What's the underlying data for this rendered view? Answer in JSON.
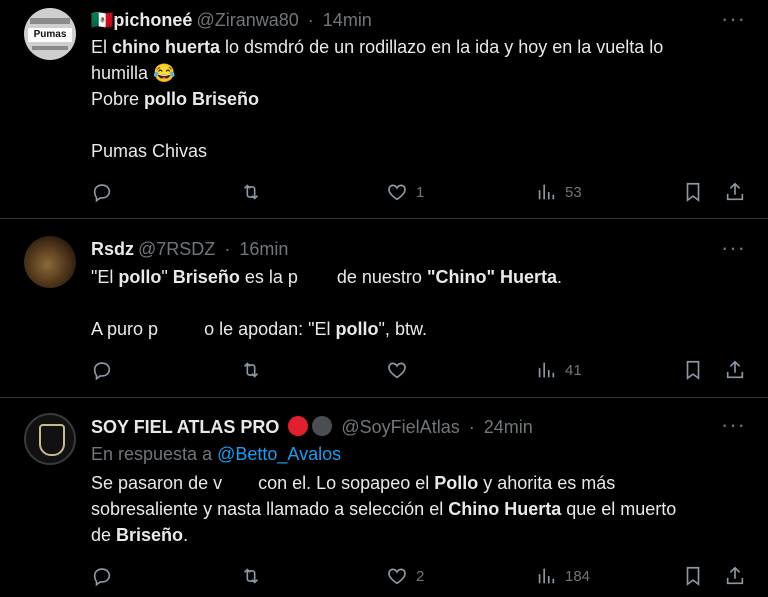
{
  "tweets": [
    {
      "name_flag": "🇲🇽",
      "name": "pichoneé",
      "handle": "@Ziranwa80",
      "sep": "·",
      "time": "14min",
      "avatar_text": "Pumas",
      "line1_a": "El ",
      "line1_b": "chino huerta",
      "line1_c": " lo dsmdró de un rodillazo en la ida y hoy en la vuelta lo",
      "line2_a": "humilla ",
      "line2_emoji": "😂",
      "line3_a": "Pobre ",
      "line3_b": "pollo Briseño",
      "line4": "Pumas Chivas",
      "replies": "",
      "retweets": "",
      "likes": "1",
      "views": "53"
    },
    {
      "name": "Rsdz",
      "handle": "@7RSDZ",
      "sep": "·",
      "time": "16min",
      "line1_a": "\"El ",
      "line1_b": "pollo",
      "line1_c": "\" ",
      "line1_d": "Briseño",
      "line1_e": " es la p",
      "line1_f": " de nuestro ",
      "line1_g": "\"Chino\" Huerta",
      "line1_h": ".",
      "line2_a": "A puro p",
      "line2_b": "o le apodan: \"El ",
      "line2_c": "pollo",
      "line2_d": "\", btw.",
      "likes": "",
      "views": "41"
    },
    {
      "name": "SOY FIEL ATLAS PRO",
      "handle": "@SoyFielAtlas",
      "sep": "·",
      "time": "24min",
      "reply_prefix": "En respuesta a ",
      "reply_user": "@Betto_Avalos",
      "line1_a": "Se pasaron de v",
      "line1_b": "con el. Lo sopapeo el ",
      "line1_c": "Pollo",
      "line1_d": " y ahorita es más",
      "line2_a": "sobresaliente y nasta llamado a selección el ",
      "line2_b": "Chino Huerta",
      "line2_c": " que el muerto",
      "line3_a": "de ",
      "line3_b": "Briseño",
      "line3_c": ".",
      "likes": "2",
      "views": "184",
      "dot1_color": "#e0202e",
      "dot2_color": "#4a4d52"
    }
  ],
  "more_glyph": "···"
}
